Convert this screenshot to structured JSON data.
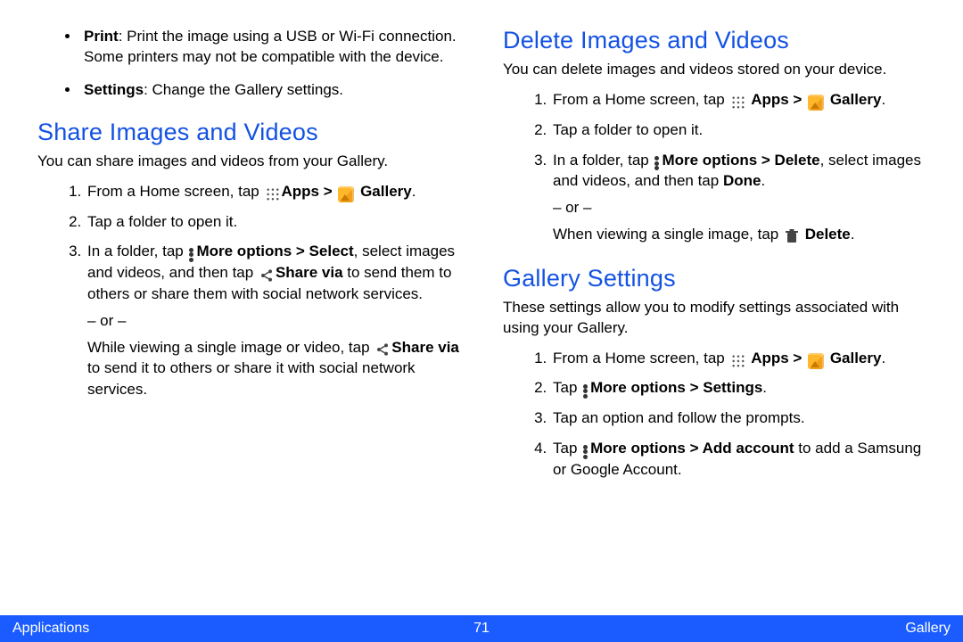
{
  "left": {
    "bullets": [
      {
        "term": "Print",
        "rest": ": Print the image using a USB or Wi-Fi connection. Some printers may not be compatible with the device."
      },
      {
        "term": "Settings",
        "rest": ": Change the Gallery settings."
      }
    ],
    "share_heading": "Share Images and Videos",
    "share_intro": "You can share images and videos from your Gallery.",
    "share_step1_pre": "From a Home screen, tap ",
    "share_step1_apps": "Apps > ",
    "share_step1_gallery": "Gallery",
    "share_step2": "Tap a folder to open it.",
    "share_step3_pre": "In a folder, tap ",
    "share_step3_more": "More options > Select",
    "share_step3_mid": ", select images and videos, and then tap ",
    "share_step3_sharevia": "Share via",
    "share_step3_end": " to send them to others or share them with social network services.",
    "share_or": "– or –",
    "share_alt_pre": "While viewing a single image or video, tap ",
    "share_alt_sharevia": "Share via",
    "share_alt_end": " to send it to others or share it with social network services."
  },
  "right": {
    "delete_heading": "Delete Images and Videos",
    "delete_intro": "You can delete images and videos stored on your device.",
    "del_step1_pre": "From a Home screen, tap ",
    "del_step1_apps": "Apps > ",
    "del_step1_gallery": "Gallery",
    "del_step2": "Tap a folder to open it.",
    "del_step3_pre": "In a folder, tap ",
    "del_step3_more": "More options > Delete",
    "del_step3_mid": ", select images and videos, and then tap ",
    "del_step3_done": "Done",
    "del_or": "– or –",
    "del_alt_pre": "When viewing a single image, tap ",
    "del_alt_delete": "Delete",
    "settings_heading": "Gallery Settings",
    "settings_intro": "These settings allow you to modify settings associated with using your Gallery.",
    "set_step1_pre": "From a Home screen, tap ",
    "set_step1_apps": "Apps > ",
    "set_step1_gallery": "Gallery",
    "set_step2_pre": "Tap ",
    "set_step2_more": "More options > Settings",
    "set_step3": "Tap an option and follow the prompts.",
    "set_step4_pre": "Tap ",
    "set_step4_more": "More options > Add account",
    "set_step4_end": " to add a Samsung or Google Account."
  },
  "footer": {
    "left": "Applications",
    "center": "71",
    "right": "Gallery"
  },
  "period": "."
}
